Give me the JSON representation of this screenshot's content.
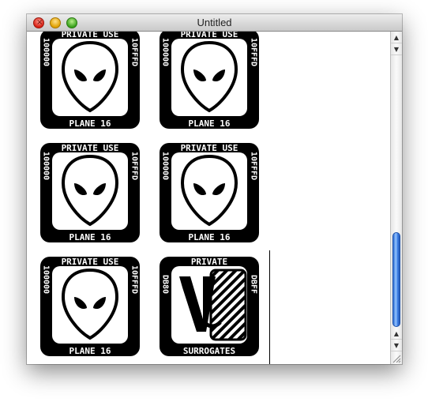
{
  "window": {
    "title": "Untitled"
  },
  "tiles": [
    {
      "top": "PRIVATE USE",
      "left": "100000",
      "right": "10FFFD",
      "bottom": "PLANE 16",
      "icon": "alien-icon"
    },
    {
      "top": "PRIVATE USE",
      "left": "100000",
      "right": "10FFFD",
      "bottom": "PLANE 16",
      "icon": "alien-icon"
    },
    {
      "top": "PRIVATE USE",
      "left": "100000",
      "right": "10FFFD",
      "bottom": "PLANE 16",
      "icon": "alien-icon"
    },
    {
      "top": "PRIVATE USE",
      "left": "100000",
      "right": "10FFFD",
      "bottom": "PLANE 16",
      "icon": "alien-icon"
    },
    {
      "top": "PRIVATE USE",
      "left": "100000",
      "right": "10FFFD",
      "bottom": "PLANE 16",
      "icon": "alien-icon"
    },
    {
      "top": "PRIVATE",
      "left": "DB80",
      "right": "DBFF",
      "bottom": "SURROGATES",
      "icon": "surrogates-icon"
    }
  ],
  "scrollbar": {
    "up_arrow": "▲",
    "down_arrow": "▼"
  }
}
